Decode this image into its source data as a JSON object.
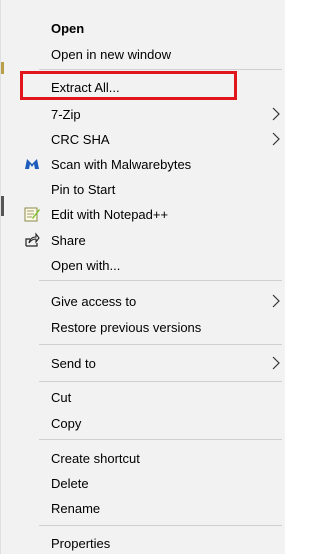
{
  "context_menu": {
    "items": [
      {
        "label": "Open",
        "bold": true
      },
      {
        "label": "Open in new window"
      },
      {
        "label": "Extract All..."
      },
      {
        "label": "7-Zip",
        "submenu": true
      },
      {
        "label": "CRC SHA",
        "submenu": true
      },
      {
        "label": "Scan with Malwarebytes",
        "icon": "malwarebytes-icon"
      },
      {
        "label": "Pin to Start"
      },
      {
        "label": "Edit with Notepad++",
        "icon": "notepad-plus-plus-icon"
      },
      {
        "label": "Share",
        "icon": "share-icon"
      },
      {
        "label": "Open with..."
      },
      {
        "label": "Give access to",
        "submenu": true
      },
      {
        "label": "Restore previous versions"
      },
      {
        "label": "Send to",
        "submenu": true
      },
      {
        "label": "Cut"
      },
      {
        "label": "Copy"
      },
      {
        "label": "Create shortcut"
      },
      {
        "label": "Delete"
      },
      {
        "label": "Rename"
      },
      {
        "label": "Properties"
      }
    ],
    "highlighted_item": "Extract All...",
    "highlight_color": "#e0161c"
  }
}
